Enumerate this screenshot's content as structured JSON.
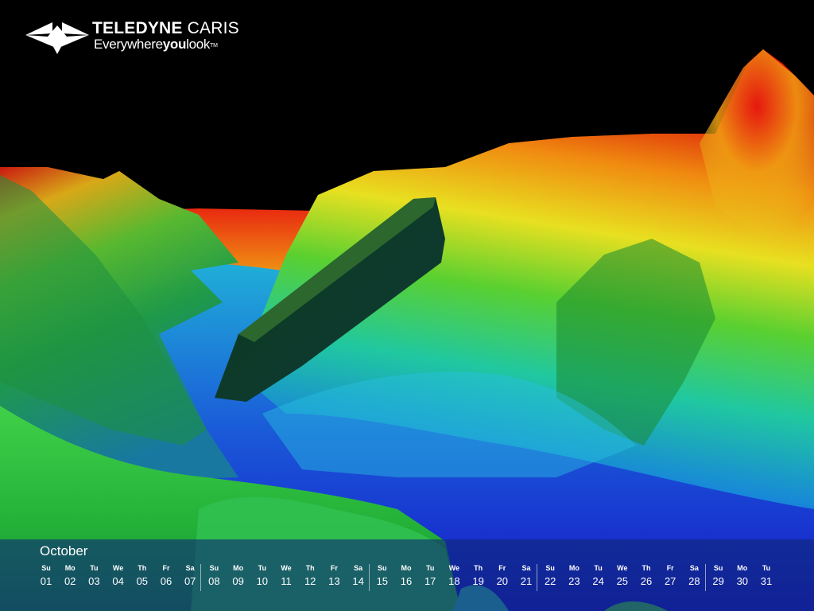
{
  "brand": {
    "name_bold": "TELEDYNE",
    "name_light": " CARIS",
    "tagline_a": "Everywhere",
    "tagline_b": "you",
    "tagline_c": "look",
    "tagline_tm": "TM"
  },
  "calendar": {
    "month": "October",
    "days": [
      {
        "dow": "Su",
        "date": "01"
      },
      {
        "dow": "Mo",
        "date": "02"
      },
      {
        "dow": "Tu",
        "date": "03"
      },
      {
        "dow": "We",
        "date": "04"
      },
      {
        "dow": "Th",
        "date": "05"
      },
      {
        "dow": "Fr",
        "date": "06"
      },
      {
        "dow": "Sa",
        "date": "07"
      },
      {
        "dow": "Su",
        "date": "08"
      },
      {
        "dow": "Mo",
        "date": "09"
      },
      {
        "dow": "Tu",
        "date": "10"
      },
      {
        "dow": "We",
        "date": "11"
      },
      {
        "dow": "Th",
        "date": "12"
      },
      {
        "dow": "Fr",
        "date": "13"
      },
      {
        "dow": "Sa",
        "date": "14"
      },
      {
        "dow": "Su",
        "date": "15"
      },
      {
        "dow": "Mo",
        "date": "16"
      },
      {
        "dow": "Tu",
        "date": "17"
      },
      {
        "dow": "We",
        "date": "18"
      },
      {
        "dow": "Th",
        "date": "19"
      },
      {
        "dow": "Fr",
        "date": "20"
      },
      {
        "dow": "Sa",
        "date": "21"
      },
      {
        "dow": "Su",
        "date": "22"
      },
      {
        "dow": "Mo",
        "date": "23"
      },
      {
        "dow": "Tu",
        "date": "24"
      },
      {
        "dow": "We",
        "date": "25"
      },
      {
        "dow": "Th",
        "date": "26"
      },
      {
        "dow": "Fr",
        "date": "27"
      },
      {
        "dow": "Sa",
        "date": "28"
      },
      {
        "dow": "Su",
        "date": "29"
      },
      {
        "dow": "Mo",
        "date": "30"
      },
      {
        "dow": "Tu",
        "date": "31"
      }
    ]
  },
  "colors": {
    "sky": "#000000",
    "deep": "#1a1ad0",
    "shallow": "#e81a10",
    "calendar_band": "#0e2878"
  }
}
